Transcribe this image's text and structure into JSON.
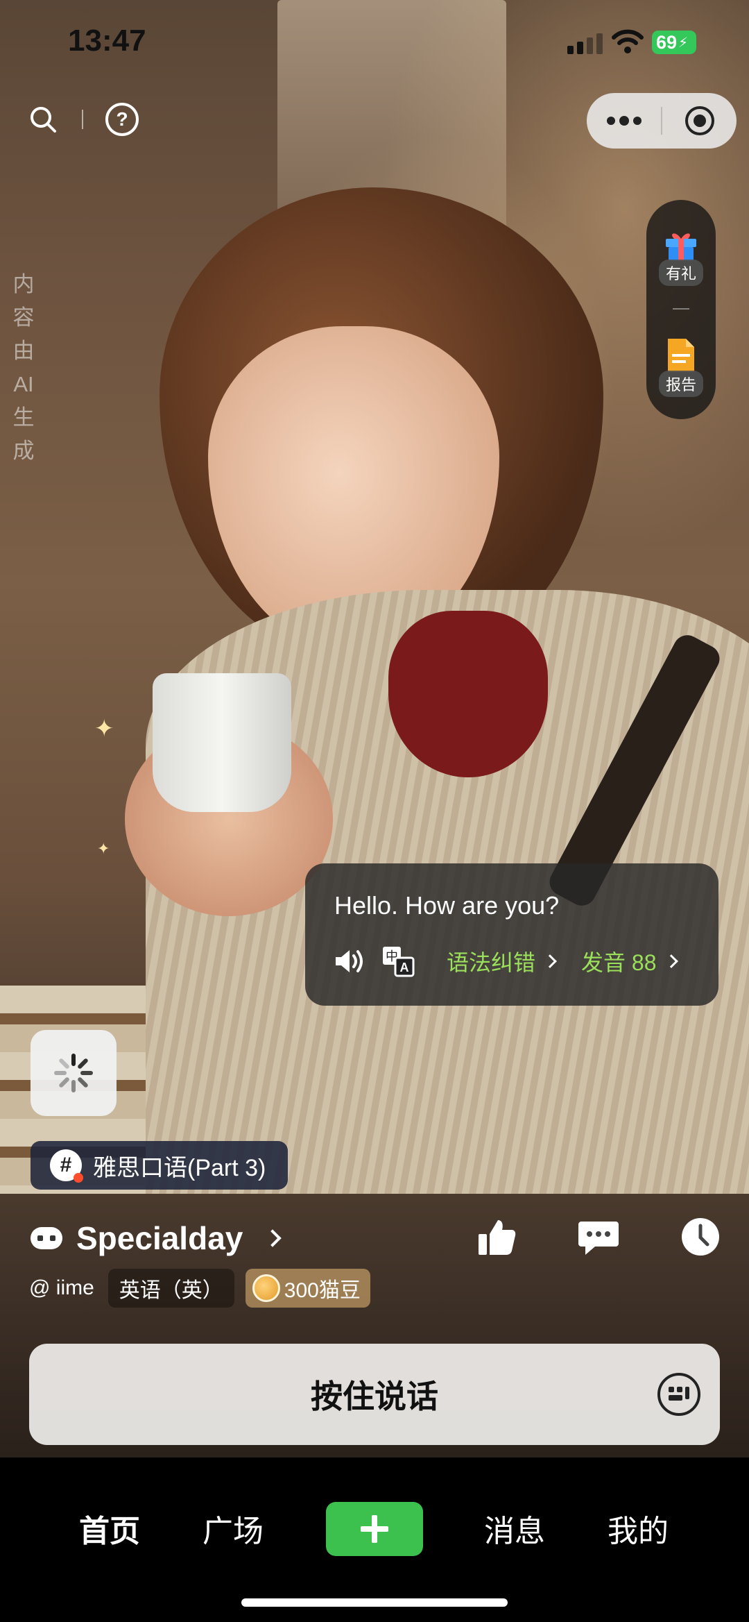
{
  "status_bar": {
    "time": "13:47",
    "battery": "69",
    "icons": [
      "signal-icon",
      "wifi-icon",
      "battery-charging-icon"
    ]
  },
  "toolbar": {
    "left_icons": [
      "search-icon",
      "help-icon"
    ],
    "capsule_icons": [
      "more-icon",
      "close-target-icon"
    ]
  },
  "ai_note": [
    "内",
    "容",
    "由",
    "AI",
    "生",
    "成"
  ],
  "side_panel": {
    "gift_label": "有礼",
    "report_label": "报告"
  },
  "bubble": {
    "text": "Hello. How are you?",
    "grammar_label": "语法纠错",
    "pronunciation_label": "发音 88",
    "icons": [
      "speaker-icon",
      "translate-icon"
    ]
  },
  "topic_tag": {
    "label": "雅思口语(Part 3)"
  },
  "character": {
    "name": "Specialday",
    "icons": [
      "character-icon",
      "like-icon",
      "comment-icon",
      "history-icon"
    ]
  },
  "meta": {
    "author": "@ iime",
    "language": "英语（英）",
    "coins": "300猫豆"
  },
  "talk_button": {
    "label": "按住说话",
    "icon": "keyboard-icon"
  },
  "bottom_nav": {
    "items": [
      "首页",
      "广场",
      "消息",
      "我的"
    ],
    "active_index": 0,
    "plus_icon": "plus-icon"
  },
  "colors": {
    "accent_green": "#3cc04e",
    "link_green": "#9be05a",
    "battery_green": "#34c759"
  }
}
